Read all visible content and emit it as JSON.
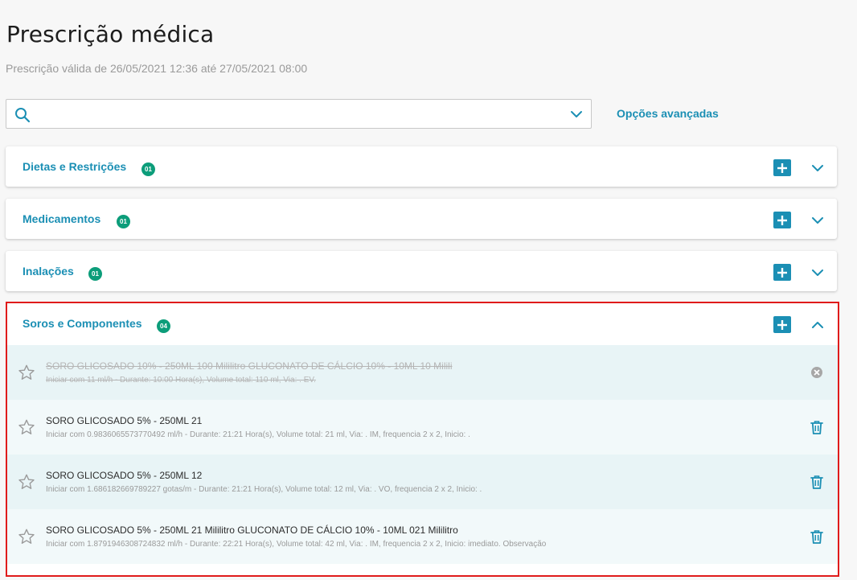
{
  "page": {
    "title": "Prescrição médica",
    "validity": "Prescrição válida de 26/05/2021 12:36 até 27/05/2021 08:00"
  },
  "search": {
    "value": "",
    "placeholder": "",
    "icon": "search-icon",
    "dropdown_icon": "chevron-down-icon"
  },
  "advanced_options": "Opções avançadas",
  "colors": {
    "accent": "#1b8fb4",
    "badge": "#0c9d7a",
    "highlight_border": "#e01b1b"
  },
  "sections": [
    {
      "title": "Dietas e Restrições",
      "count": "01",
      "expanded": false
    },
    {
      "title": "Medicamentos",
      "count": "01",
      "expanded": false
    },
    {
      "title": "Inalações",
      "count": "01",
      "expanded": false
    },
    {
      "title": "Soros e Componentes",
      "count": "04",
      "expanded": true
    }
  ],
  "soros_items": [
    {
      "title": "SORO GLICOSADO 10% - 250ML 100 Mililitro GLUCONATO DE CÁLCIO 10% - 10ML 10 Milili",
      "detail": "Iniciar com 11 ml/h - Durante: 10:00 Hora(s), Volume total: 110 ml, Via: . EV.",
      "status": "suspended",
      "action_icon": "close-circle-icon"
    },
    {
      "title": "SORO GLICOSADO 5% - 250ML 21",
      "detail": "Iniciar com 0.9836065573770492 ml/h - Durante: 21:21 Hora(s), Volume total: 21 ml, Via: . IM, frequencia 2 x 2, Inicio: .",
      "status": "active",
      "action_icon": "trash-icon"
    },
    {
      "title": "SORO GLICOSADO 5% - 250ML 12",
      "detail": "Iniciar com 1.686182669789227 gotas/m - Durante: 21:21 Hora(s), Volume total: 12 ml, Via: . VO, frequencia 2 x 2, Inicio: .",
      "status": "active",
      "action_icon": "trash-icon"
    },
    {
      "title": "SORO GLICOSADO 5% - 250ML 21 Mililitro GLUCONATO DE CÁLCIO 10% - 10ML 021 Mililitro",
      "detail": "Iniciar com 1.8791946308724832 ml/h - Durante: 22:21 Hora(s), Volume total: 42 ml, Via: . IM, frequencia 2 x 2, Inicio: imediato. Observação",
      "status": "active",
      "action_icon": "trash-icon"
    }
  ]
}
